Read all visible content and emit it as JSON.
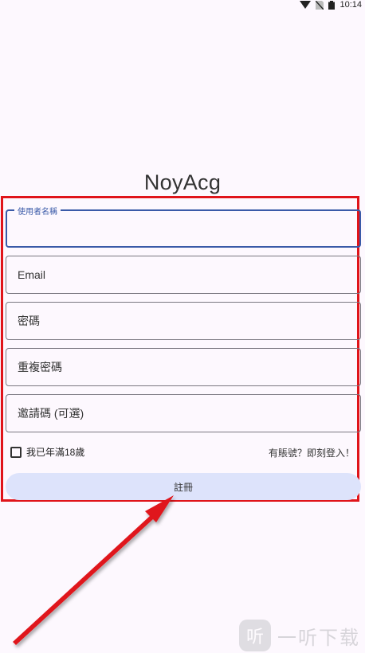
{
  "status_bar": {
    "time": "10:14",
    "icons": [
      "wifi-icon",
      "no-sim-icon",
      "battery-icon"
    ]
  },
  "app": {
    "title": "NoyAcg"
  },
  "form": {
    "username": {
      "label": "使用者名稱",
      "value": ""
    },
    "email": {
      "placeholder": "Email",
      "value": ""
    },
    "password": {
      "placeholder": "密碼",
      "value": ""
    },
    "confirm_password": {
      "placeholder": "重複密碼",
      "value": ""
    },
    "invite_code": {
      "placeholder": "邀請碼 (可選)",
      "value": ""
    },
    "age_check": {
      "label": "我已年滿18歲",
      "checked": false
    },
    "login_link": "有賬號？即刻登入！",
    "register_button": "註冊"
  },
  "annotation": {
    "box_color": "#e0141a",
    "arrow_color": "#e0141a"
  },
  "watermark": {
    "logo_glyph": "听",
    "text": "一听下载"
  }
}
